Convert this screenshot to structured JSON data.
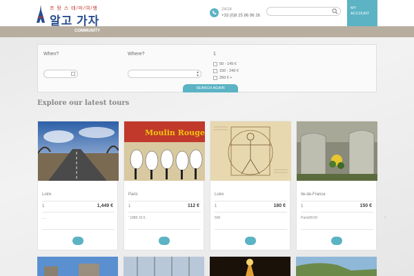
{
  "header": {
    "logo_sub": "프 랑 스 테/마/여/행",
    "logo_main": "알고 가자",
    "phone_hours": "24/24",
    "phone_number": "+33 (0)8 25 86 96 26",
    "account_label": "MY ACCOUNT"
  },
  "nav": {
    "items": [
      "",
      "",
      " ",
      "COMMUNITY"
    ]
  },
  "search_panel": {
    "when_label": "When?",
    "where_label": "Where?",
    "count": "1",
    "price_filters": [
      "50 - 149 €",
      "150 - 249 €",
      "250 € +"
    ],
    "search_button": "SEARCH AGAIN"
  },
  "section_title": "Explore our latest tours",
  "tours": [
    {
      "location": "Loire",
      "count": "1",
      "price": "1,449 €",
      "desc": " ..  .. ",
      "image": "road-icon"
    },
    {
      "location": "Paris",
      "count": "1",
      "price": "112 €",
      "desc": "' 1889 10 6 .",
      "image": "moulin-rouge-icon"
    },
    {
      "location": "Loire",
      "count": "1",
      "price": "180 €",
      "desc": "500 ",
      "image": "vitruvian-icon"
    },
    {
      "location": "Ile-de-France",
      "count": "1",
      "price": "150 €",
      "desc": "Paris08:00 ",
      "image": "graves-icon"
    }
  ],
  "colors": {
    "accent": "#5bb3c4",
    "nav": "#b8aea0",
    "logo_blue": "#2a4d8f",
    "logo_red": "#c0392b"
  }
}
